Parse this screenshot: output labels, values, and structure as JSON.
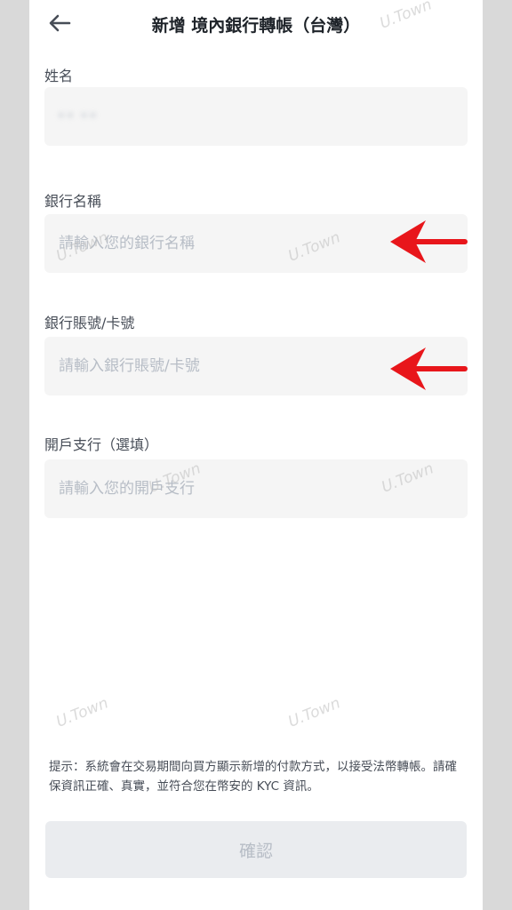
{
  "header": {
    "title": "新增 境內銀行轉帳（台灣）"
  },
  "fields": [
    {
      "label": "姓名",
      "value": "•• ••",
      "placeholder": ""
    },
    {
      "label": "銀行名稱",
      "value": "",
      "placeholder": "請輸入您的銀行名稱"
    },
    {
      "label": "銀行賬號/卡號",
      "value": "",
      "placeholder": "請輸入銀行賬號/卡號"
    },
    {
      "label": "開戶支行（選填）",
      "value": "",
      "placeholder": "請輸入您的開戶支行"
    }
  ],
  "watermark": "U.Town",
  "hint": "提示：系統會在交易期間向買方顯示新增的付款方式，以接受法幣轉帳。請確保資訊正確、真實，並符合您在幣安的 KYC 資訊。",
  "confirm_label": "確認",
  "colors": {
    "arrow": "#e8161b",
    "input_bg": "#f5f5f5",
    "button_bg": "#eaecef"
  }
}
